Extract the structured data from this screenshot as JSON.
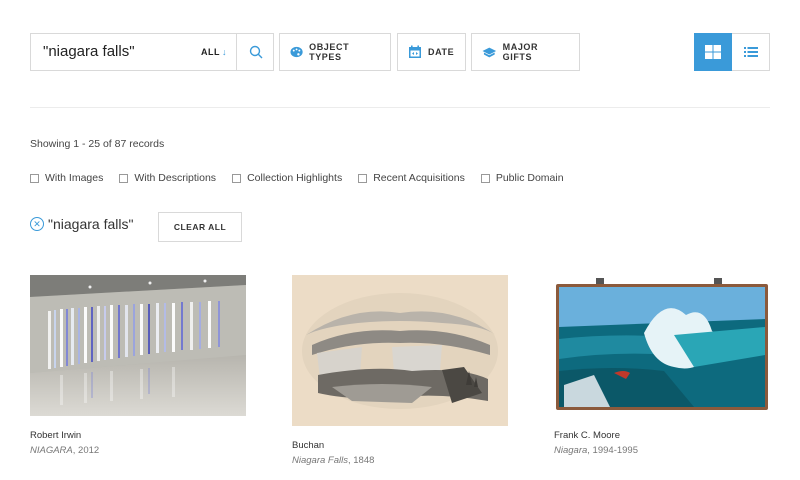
{
  "search": {
    "value": "\"niagara falls\"",
    "scope_label": "ALL",
    "scope_arrow": "↓"
  },
  "filters": [
    {
      "label": "OBJECT TYPES",
      "icon": "palette-icon"
    },
    {
      "label": "DATE",
      "icon": "calendar-icon"
    },
    {
      "label": "MAJOR GIFTS",
      "icon": "gift-icon"
    }
  ],
  "view": {
    "active": "grid",
    "grid_icon": "grid-icon",
    "list_icon": "list-icon"
  },
  "accent_color": "#3a9ad9",
  "results_count": "Showing 1 - 25 of 87 records",
  "checkbox_filters": [
    "With Images",
    "With Descriptions",
    "Collection Highlights",
    "Recent Acquisitions",
    "Public Domain"
  ],
  "active_filter": {
    "label": "\"niagara falls\""
  },
  "clear_all_label": "CLEAR ALL",
  "results": [
    {
      "artist": "Robert Irwin",
      "title": "NIAGARA",
      "date": ", 2012"
    },
    {
      "artist": "Buchan",
      "title": "Niagara Falls",
      "date": ", 1848"
    },
    {
      "artist": "Frank C. Moore",
      "title": "Niagara",
      "date": ", 1994-1995"
    }
  ]
}
